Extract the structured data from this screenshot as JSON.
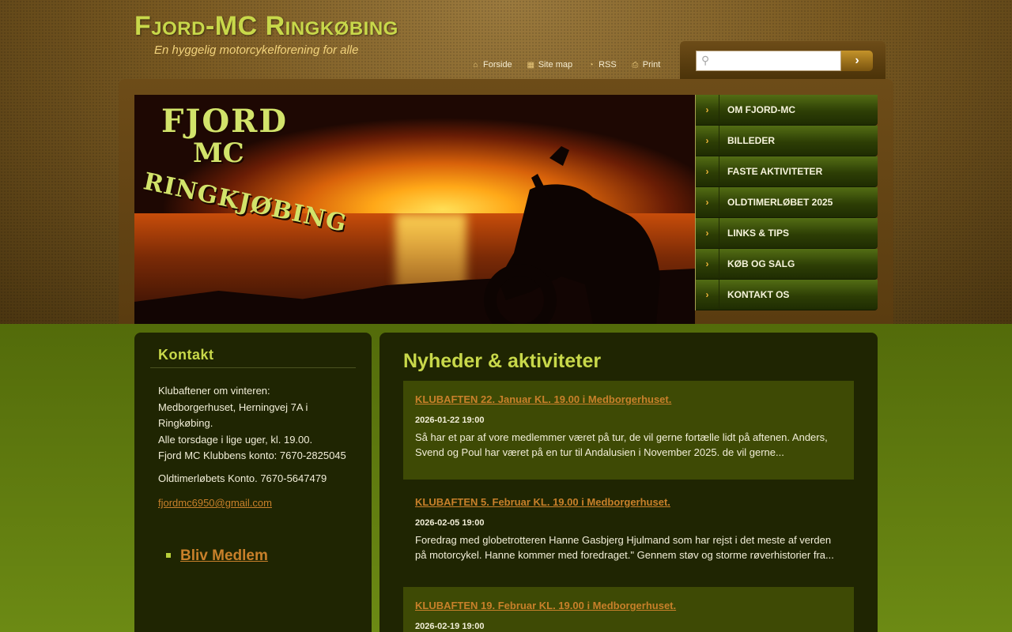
{
  "header": {
    "title": "Fjord-MC Ringkøbing",
    "slogan": "En hyggelig motorcykelforening for alle",
    "links": [
      {
        "label": "Forside",
        "icon": "home-icon"
      },
      {
        "label": "Site map",
        "icon": "sitemap-icon"
      },
      {
        "label": "RSS",
        "icon": "rss-icon"
      },
      {
        "label": "Print",
        "icon": "print-icon"
      }
    ],
    "search": {
      "placeholder": "",
      "value": ""
    }
  },
  "banner": {
    "logo_lines": [
      "FJORD",
      "MC",
      "RINGKJØBING"
    ]
  },
  "menu": {
    "items": [
      {
        "label": "OM FJORD-MC"
      },
      {
        "label": "BILLEDER"
      },
      {
        "label": "FASTE AKTIVITETER"
      },
      {
        "label": "OLDTIMERLØBET 2025"
      },
      {
        "label": "LINKS & TIPS"
      },
      {
        "label": "KØB OG SALG"
      },
      {
        "label": "KONTAKT OS"
      }
    ]
  },
  "sidebar": {
    "title": "Kontakt",
    "lines": [
      "Klubaftener om vinteren:",
      "Medborgerhuset, Herningvej 7A i Ringkøbing.",
      "Alle torsdage i lige uger, kl. 19.00.",
      "Fjord MC Klubbens konto: 7670-2825045"
    ],
    "konto2": "Oldtimerløbets Konto. 7670-5647479",
    "email": "fjordmc6950@gmail.com",
    "member_link": "Bliv Medlem"
  },
  "main": {
    "title": "Nyheder & aktiviteter",
    "news": [
      {
        "title": "KLUBAFTEN 22. Januar KL. 19.00 i Medborgerhuset.",
        "date": "2026-01-22 19:00",
        "body": "Så har et par af vore medlemmer været på tur, de vil gerne fortælle lidt på aftenen. Anders, Svend og Poul har været på en tur til Andalusien i November 2025. de vil gerne..."
      },
      {
        "title": "KLUBAFTEN 5. Februar KL. 19.00 i Medborgerhuset.",
        "date": "2026-02-05 19:00",
        "body": "Foredrag med globetrotteren Hanne Gasbjerg Hjulmand som har rejst i det meste af verden på motorcykel. Hanne kommer med foredraget.\" Gennem støv og storme røverhistorier fra..."
      },
      {
        "title": "KLUBAFTEN 19. Februar KL. 19.00 i Medborgerhuset.",
        "date": "2026-02-19 19:00",
        "body": ""
      }
    ]
  },
  "colors": {
    "title_green": "#c8d84a",
    "link_orange": "#c8802a",
    "panel_dark": "#1f2502",
    "news_highlight": "#3e4a05",
    "menu_arrow": "#f0b53a"
  }
}
